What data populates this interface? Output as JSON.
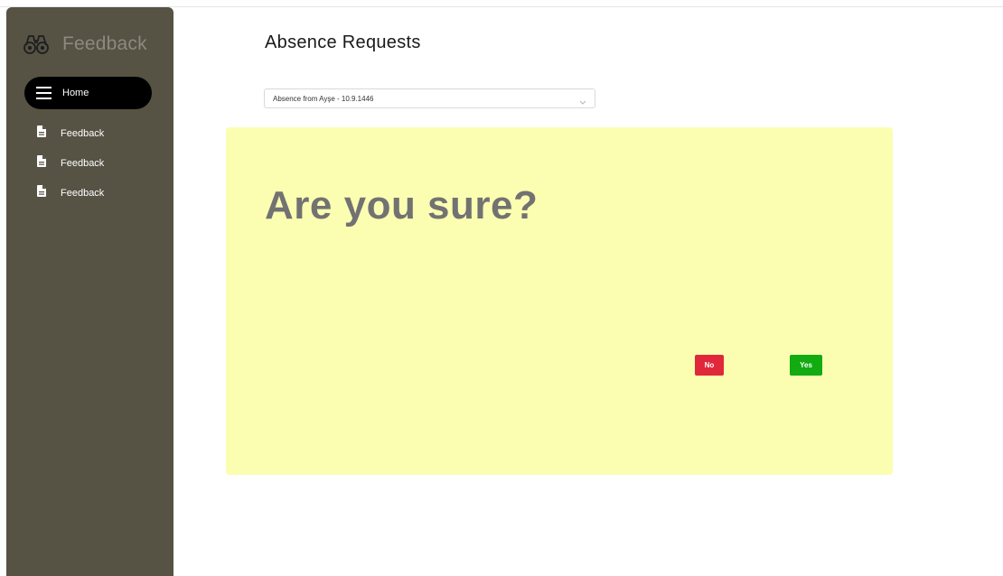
{
  "sidebar": {
    "brand": {
      "text": "Feedback",
      "icon": "binoculars-icon"
    },
    "home": {
      "label": "Home",
      "icon": "hamburger-menu-icon"
    },
    "items": [
      {
        "label": "Feedback",
        "icon": "document-icon"
      },
      {
        "label": "Feedback",
        "icon": "document-icon"
      },
      {
        "label": "Feedback",
        "icon": "document-icon"
      }
    ]
  },
  "main": {
    "title": "Absence Requests",
    "select": {
      "value": "Absence from Ayşe - 10.9.1446",
      "icon": "chevron-down-icon"
    },
    "confirm": {
      "question": "Are you sure?",
      "no_label": "No",
      "yes_label": "Yes"
    }
  },
  "colors": {
    "sidebar_bg": "#565244",
    "panel_bg": "#fbfeb1",
    "no_button": "#e0283a",
    "yes_button": "#12ab12",
    "home_pill": "#000000"
  }
}
